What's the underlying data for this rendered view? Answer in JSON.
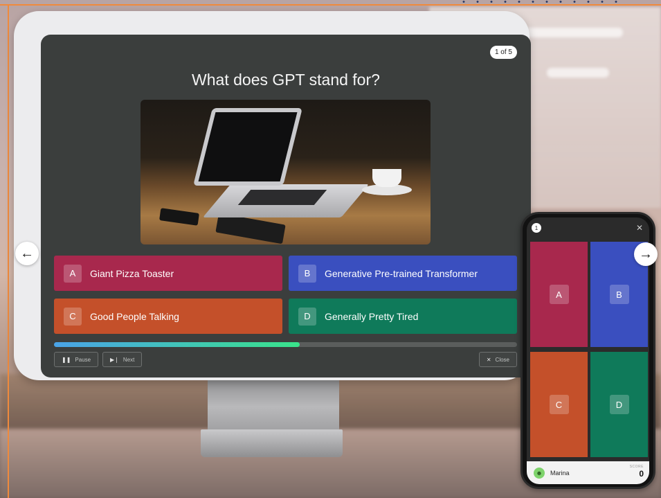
{
  "quiz": {
    "counter": "1 of 5",
    "question": "What does GPT stand for?",
    "image_alt": "Laptop on a wooden table with a coffee cup",
    "answers": [
      {
        "letter": "A",
        "text": "Giant Pizza Toaster",
        "color": "#a8284d"
      },
      {
        "letter": "B",
        "text": "Generative Pre-trained Transformer",
        "color": "#3a4fbf"
      },
      {
        "letter": "C",
        "text": "Good People Talking",
        "color": "#c4502a"
      },
      {
        "letter": "D",
        "text": "Generally Pretty Tired",
        "color": "#0f7a5a"
      }
    ],
    "progress_fraction": 0.53,
    "controls": {
      "pause_label": "Pause",
      "next_label": "Next",
      "close_label": "Close"
    }
  },
  "nav": {
    "prev_icon": "arrow-left-icon",
    "next_icon": "arrow-right-icon"
  },
  "phone": {
    "badge": "1",
    "tiles": [
      "A",
      "B",
      "C",
      "D"
    ],
    "player_name": "Marina",
    "score_label": "SCORE",
    "score_value": "0"
  }
}
